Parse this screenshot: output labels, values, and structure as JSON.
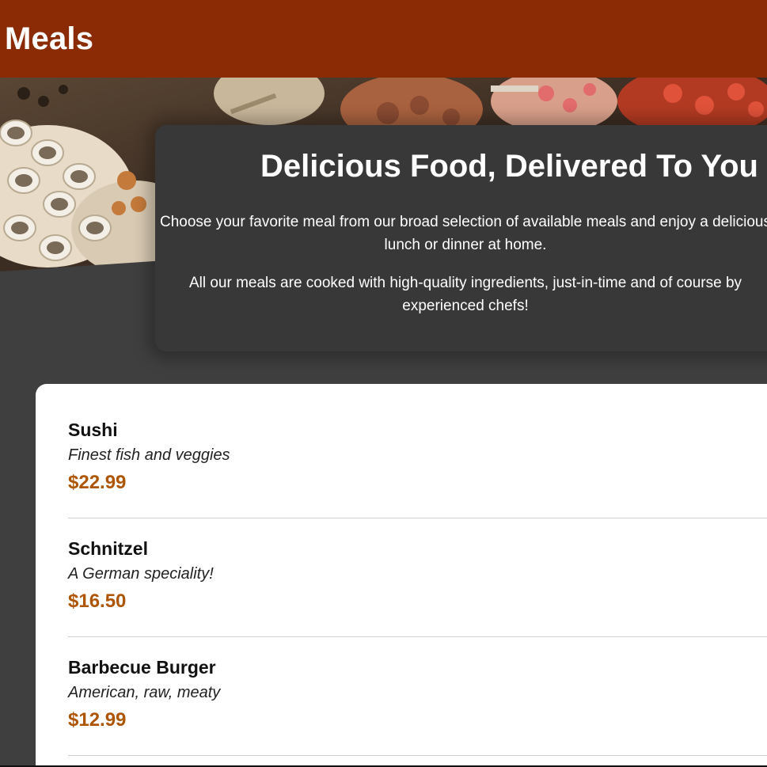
{
  "header": {
    "title": "Meals"
  },
  "summary": {
    "title": "Delicious Food, Delivered To You",
    "paragraph1": "Choose your favorite meal from our broad selection of available meals and enjoy a delicious lunch or dinner at home.",
    "paragraph2": "All our meals are cooked with high-quality ingredients, just-in-time and of course by experienced chefs!"
  },
  "meals": [
    {
      "name": "Sushi",
      "description": "Finest fish and veggies",
      "price": "$22.99"
    },
    {
      "name": "Schnitzel",
      "description": "A German speciality!",
      "price": "$16.50"
    },
    {
      "name": "Barbecue Burger",
      "description": "American, raw, meaty",
      "price": "$12.99"
    }
  ],
  "colors": {
    "header": "#8a2b06",
    "background": "#3f3f3f",
    "summary_card": "#383838",
    "price": "#ad5502"
  }
}
